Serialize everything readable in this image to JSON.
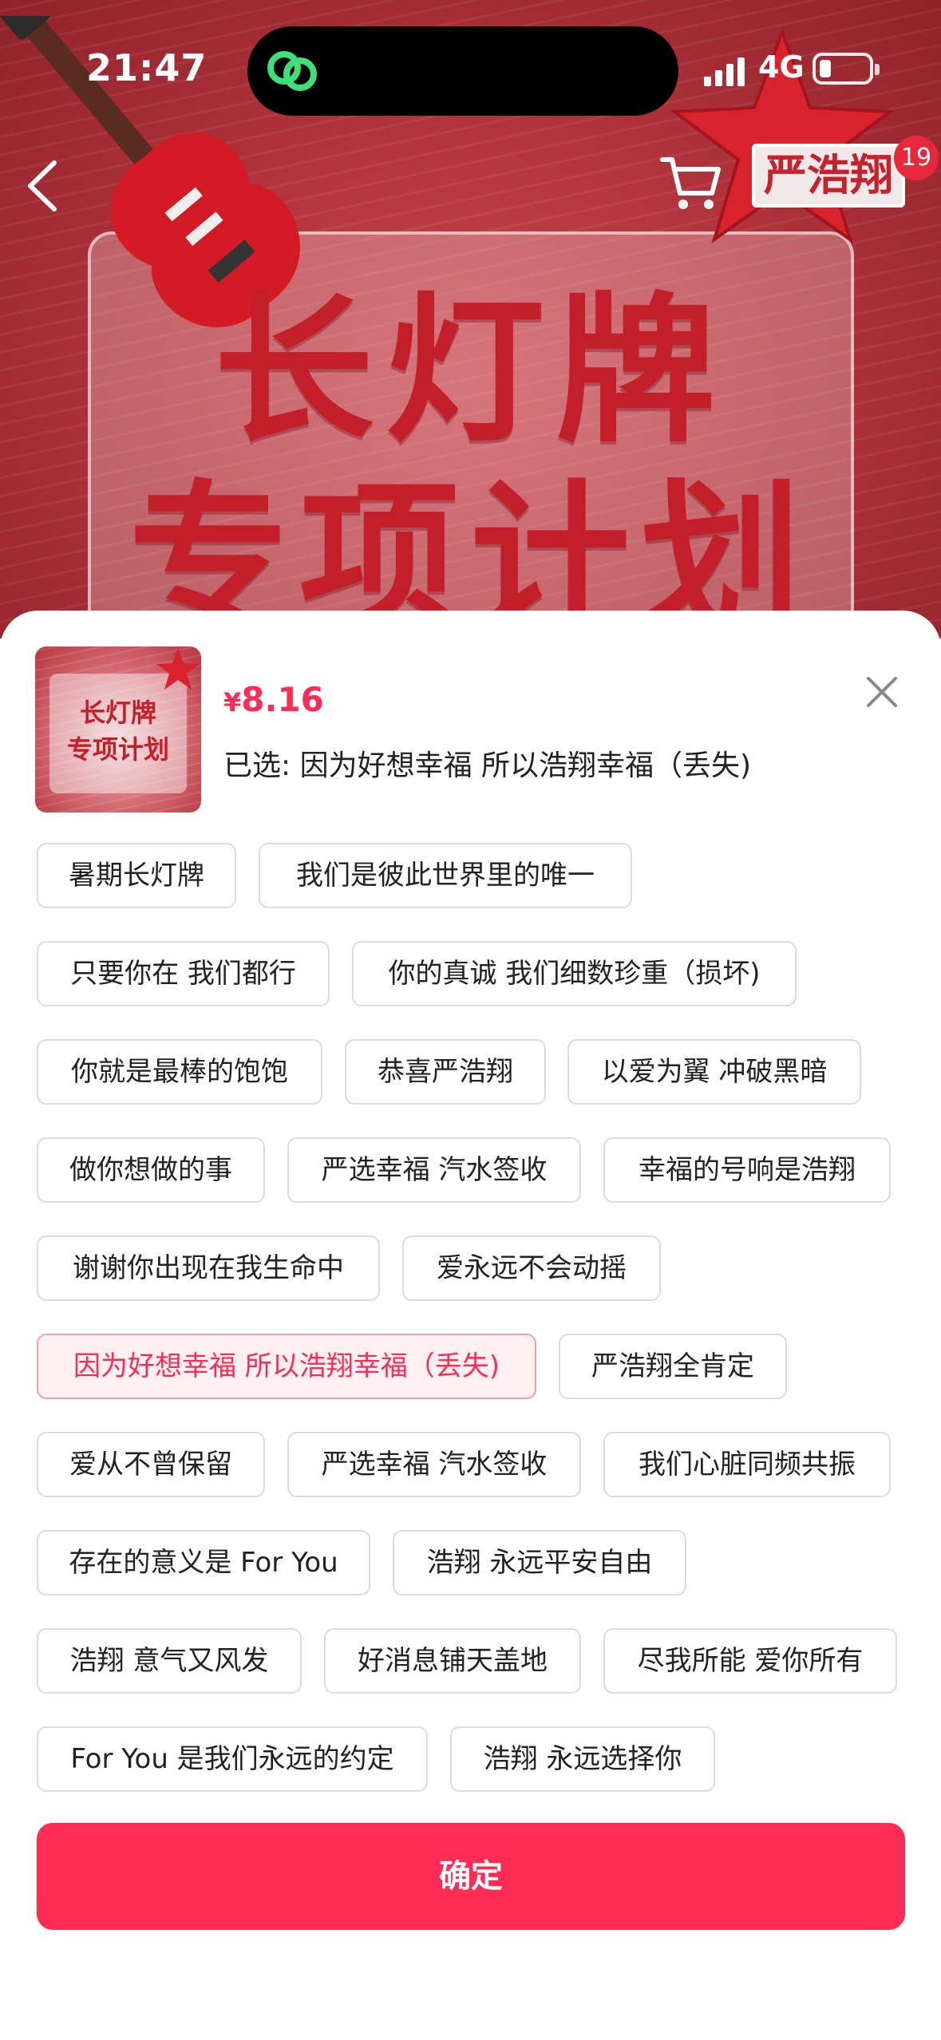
{
  "status_bar": {
    "time": "21:47",
    "network": "4G"
  },
  "hero": {
    "title_line1": "长灯牌",
    "title_line2": "专项计划",
    "brand_logo": "严浩翔",
    "cart_badge": "19"
  },
  "sheet": {
    "thumbnail": {
      "line1": "长灯牌",
      "line2": "专项计划"
    },
    "price_currency": "¥",
    "price_amount": "8.16",
    "selected_text": "已选: 因为好想幸福 所以浩翔幸福（丢失)",
    "options": [
      {
        "label": "暑期长灯牌"
      },
      {
        "label": "我们是彼此世界里的唯一"
      },
      {
        "label": "只要你在 我们都行"
      },
      {
        "label": "你的真诚 我们细数珍重（损坏)"
      },
      {
        "label": "你就是最棒的饱饱"
      },
      {
        "label": "恭喜严浩翔"
      },
      {
        "label": "以爱为翼 冲破黑暗"
      },
      {
        "label": "做你想做的事"
      },
      {
        "label": "严选幸福 汽水签收"
      },
      {
        "label": "幸福的号响是浩翔"
      },
      {
        "label": "谢谢你出现在我生命中"
      },
      {
        "label": "爱永远不会动摇"
      },
      {
        "label": "因为好想幸福 所以浩翔幸福（丢失)"
      },
      {
        "label": "严浩翔全肯定"
      },
      {
        "label": "爱从不曾保留"
      },
      {
        "label": "严选幸福 汽水签收"
      },
      {
        "label": "我们心脏同频共振"
      },
      {
        "label": "存在的意义是 For You"
      },
      {
        "label": "浩翔 永远平安自由"
      },
      {
        "label": "浩翔 意气又风发"
      },
      {
        "label": "好消息铺天盖地"
      },
      {
        "label": "尽我所能 爱你所有"
      },
      {
        "label": "For You 是我们永远的约定"
      },
      {
        "label": "浩翔 永远选择你"
      }
    ],
    "confirm_label": "确定"
  }
}
